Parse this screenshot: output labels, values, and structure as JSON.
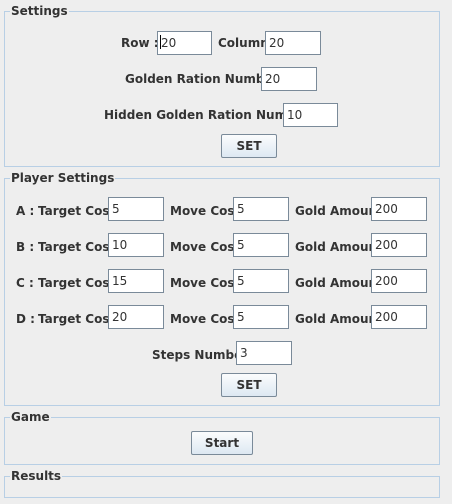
{
  "settings": {
    "title": "Settings",
    "row_label": "Row :",
    "row_value": "20",
    "column_label": "Column",
    "column_value": "20",
    "golden_label": "Golden Ration Number :",
    "golden_value": "20",
    "hidden_golden_label": "Hidden Golden Ration Number :",
    "hidden_golden_value": "10",
    "set_label": "SET"
  },
  "player_settings": {
    "title": "Player Settings",
    "target_cost_label": "Target Cost",
    "move_cost_label": "Move Cost",
    "gold_amount_label": "Gold Amount",
    "players": [
      {
        "label": "A :",
        "target_cost": "5",
        "move_cost": "5",
        "gold_amount": "200"
      },
      {
        "label": "B :",
        "target_cost": "10",
        "move_cost": "5",
        "gold_amount": "200"
      },
      {
        "label": "C :",
        "target_cost": "15",
        "move_cost": "5",
        "gold_amount": "200"
      },
      {
        "label": "D :",
        "target_cost": "20",
        "move_cost": "5",
        "gold_amount": "200"
      }
    ],
    "steps_label": "Steps Number",
    "steps_value": "3",
    "set_label": "SET"
  },
  "game": {
    "title": "Game",
    "start_label": "Start"
  },
  "results": {
    "title": "Results"
  }
}
